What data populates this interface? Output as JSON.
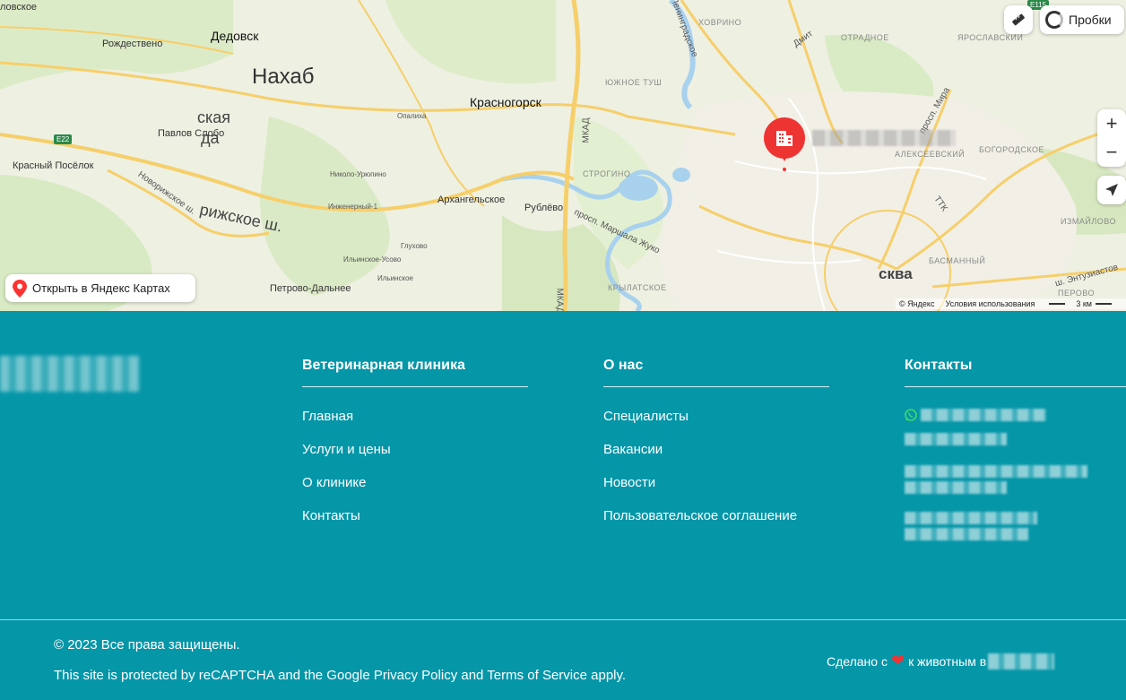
{
  "map": {
    "places": {
      "lobskoe": "ловское",
      "rozhdestveno": "Рождествено",
      "dedovsk": "Дедовск",
      "nakhabino": "Нахаб",
      "krasnogorsk": "Красногорск",
      "khovrino": "ХОВРИНО",
      "otradnoe": "ОТРАДНОЕ",
      "yaroslavsky": "ЯРОСЛАВСКИЙ",
      "yuzhnoe_tushino": "ЮЖНОЕ ТУШ",
      "pavlovskaya_sloboda": "Павлов Слобо",
      "krasny_posyolok": "Красный Посёлок",
      "arkhangelskoe": "Архангельское",
      "rublyovo": "Рублёво",
      "strogino": "СТРОГИНО",
      "alekseevsky": "АЛЕКСЕЕВСКИЙ",
      "bogorodskoe": "БОГОРОДСКОЕ",
      "izmaylovo": "ИЗМАЙЛОВО",
      "basmanny": "БАСМАННЫЙ",
      "moskva": "сква",
      "krylatskoe": "КРЫЛАТСКОЕ",
      "petrovo_dalnee": "Петрово-Дальнее",
      "perovo": "ПЕРОВО",
      "ska": "ская",
      "da": "да",
      "nikolo_uryupino": "Николо-Урюпино",
      "inzhenerny": "Инженерный-1",
      "ilinskoe_usovo": "Ильинское-Усово",
      "glukhovo": "Глухово",
      "ilinskoe": "Ильинское",
      "opalikha": "Опалиха"
    },
    "roads": {
      "e22": "E22",
      "e115": "E115",
      "novorizhskoe": "Новорижское ш.",
      "rizhskoe": "рижское ш.",
      "mkad": "МКАД",
      "mkad2": "МКАД",
      "marshala_zhukova": "просп. Маршала Жуко",
      "dmit": "Дмит",
      "mira": "просп. Мира",
      "leningradskoe": "Ленинградское",
      "ttk": "ТТК",
      "entuziastov": "ш. Энтузиастов"
    },
    "traffic_label": "Пробки",
    "open_in_maps": "Открыть в Яндекс Картах",
    "copyright": "© Яндекс",
    "terms": "Условия использования",
    "scale": "3 км",
    "zoom_in": "+",
    "zoom_out": "−"
  },
  "footer": {
    "col1": {
      "title": "Ветеринарная клиника",
      "links": [
        "Главная",
        "Услуги и цены",
        "О клинике",
        "Контакты"
      ]
    },
    "col2": {
      "title": "О нас",
      "links": [
        "Специалисты",
        "Вакансии",
        "Новости",
        "Пользовательское соглашение"
      ]
    },
    "col3": {
      "title": "Контакты"
    },
    "copyright": "© 2023 Все права защищены.",
    "recaptcha": "This site is protected by reCAPTCHA and the Google Privacy Policy and Terms of Service apply.",
    "made_prefix": "Сделано с",
    "made_suffix": "к животным в"
  },
  "colors": {
    "footer_bg": "#0596a8",
    "pin": "#ee3333"
  }
}
